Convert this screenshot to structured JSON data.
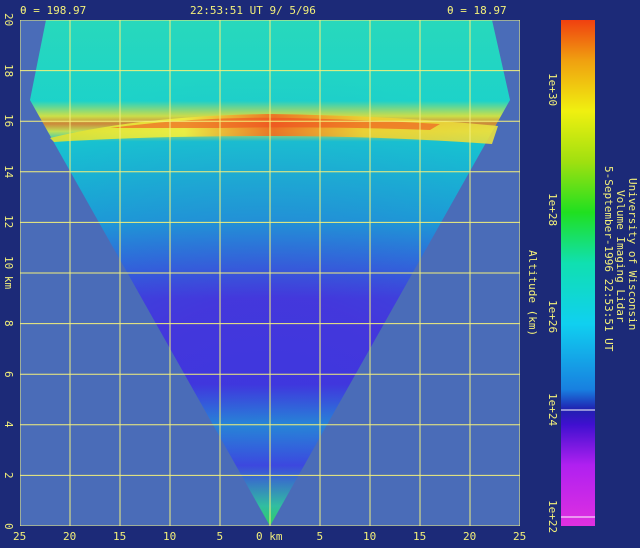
{
  "header": {
    "theta_left": "θ = 198.97",
    "timestamp": "22:53:51 UT  9/ 5/96",
    "theta_right": "θ = 18.97"
  },
  "axes": {
    "y_ticks": [
      "0",
      "2",
      "4",
      "6",
      "8",
      "10 km",
      "12",
      "14",
      "16",
      "18",
      "20"
    ],
    "x_ticks": [
      "25",
      "20",
      "15",
      "10",
      "5",
      "0 km",
      "5",
      "10",
      "15",
      "20",
      "25"
    ],
    "y_label": "Altitude (km)"
  },
  "colorbar": {
    "ticks": [
      "1e+22",
      "1e+24",
      "1e+26",
      "1e+28",
      "1e+30"
    ]
  },
  "credits": {
    "line1": "University of Wisconsin",
    "line2": "Volume Imaging Lidar",
    "line3": "5-September-1996 22:53:51 UT"
  },
  "colors": {
    "background": "#1c2a78",
    "plot_bg": "#4a6cb8",
    "grid": "#f3f07a"
  }
}
